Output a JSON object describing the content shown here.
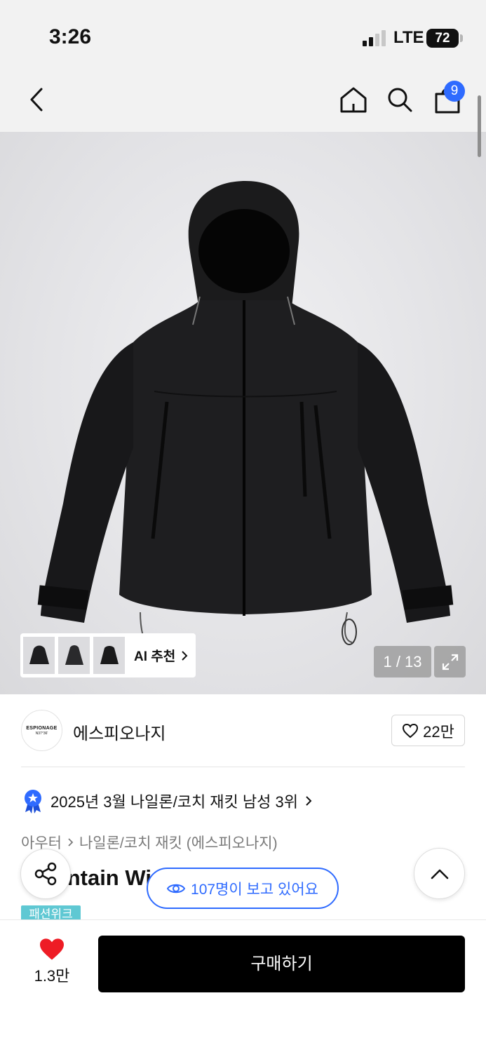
{
  "status_bar": {
    "time": "3:26",
    "network": "LTE",
    "battery": "72"
  },
  "nav": {
    "cart_count": "9"
  },
  "gallery": {
    "counter": "1 / 13",
    "ai_label": "AI 추천"
  },
  "brand": {
    "logo_line1": "ESPIONAGE",
    "logo_line2": "N37°36'",
    "name": "에스피오나지",
    "likes": "22만"
  },
  "ranking": {
    "text": "2025년 3월 나일론/코치 재킷 남성 3위"
  },
  "breadcrumb": {
    "category": "아우터",
    "subcategory": "나일론/코치 재킷 (에스피오나지)"
  },
  "product": {
    "title_visible": "Mountain Wi",
    "tag": "패션위크"
  },
  "viewers": {
    "text": "107명이 보고 있어요"
  },
  "bottom": {
    "heart_count": "1.3만",
    "buy_label": "구매하기"
  },
  "colors": {
    "accent_blue": "#2f6bff",
    "heart_red": "#ee1c25",
    "tag_teal": "#5fc8d3"
  },
  "icons": [
    "back-icon",
    "home-icon",
    "search-icon",
    "bag-icon",
    "expand-icon",
    "heart-outline-icon",
    "medal-icon",
    "share-icon",
    "eye-icon",
    "chevron-up-icon",
    "heart-filled-icon"
  ]
}
